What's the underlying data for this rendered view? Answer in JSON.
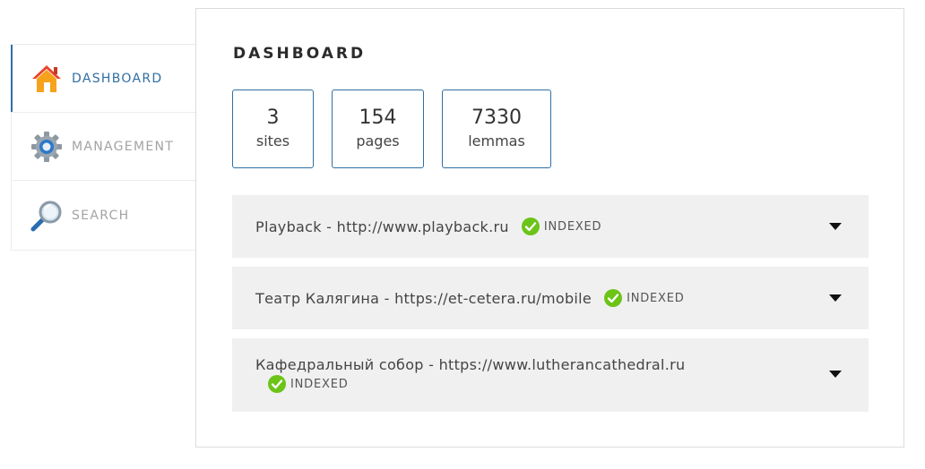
{
  "sidebar": {
    "items": [
      {
        "label": "DASHBOARD",
        "icon": "home-icon",
        "active": true
      },
      {
        "label": "MANAGEMENT",
        "icon": "gear-icon",
        "active": false
      },
      {
        "label": "SEARCH",
        "icon": "magnifier-icon",
        "active": false
      }
    ]
  },
  "main": {
    "title": "DASHBOARD",
    "stats": [
      {
        "value": "3",
        "label": "sites"
      },
      {
        "value": "154",
        "label": "pages"
      },
      {
        "value": "7330",
        "label": "lemmas"
      }
    ],
    "sites": [
      {
        "name": "Playback - http://www.playback.ru",
        "status": "INDEXED"
      },
      {
        "name": "Театр Калягина - https://et-cetera.ru/mobile",
        "status": "INDEXED"
      },
      {
        "name": "Кафедральный собор - https://www.lutherancathedral.ru",
        "status": "INDEXED"
      }
    ]
  },
  "colors": {
    "accent": "#2f6fa4",
    "indexed": "#6cc418",
    "card_bg": "#f0f0f0"
  }
}
